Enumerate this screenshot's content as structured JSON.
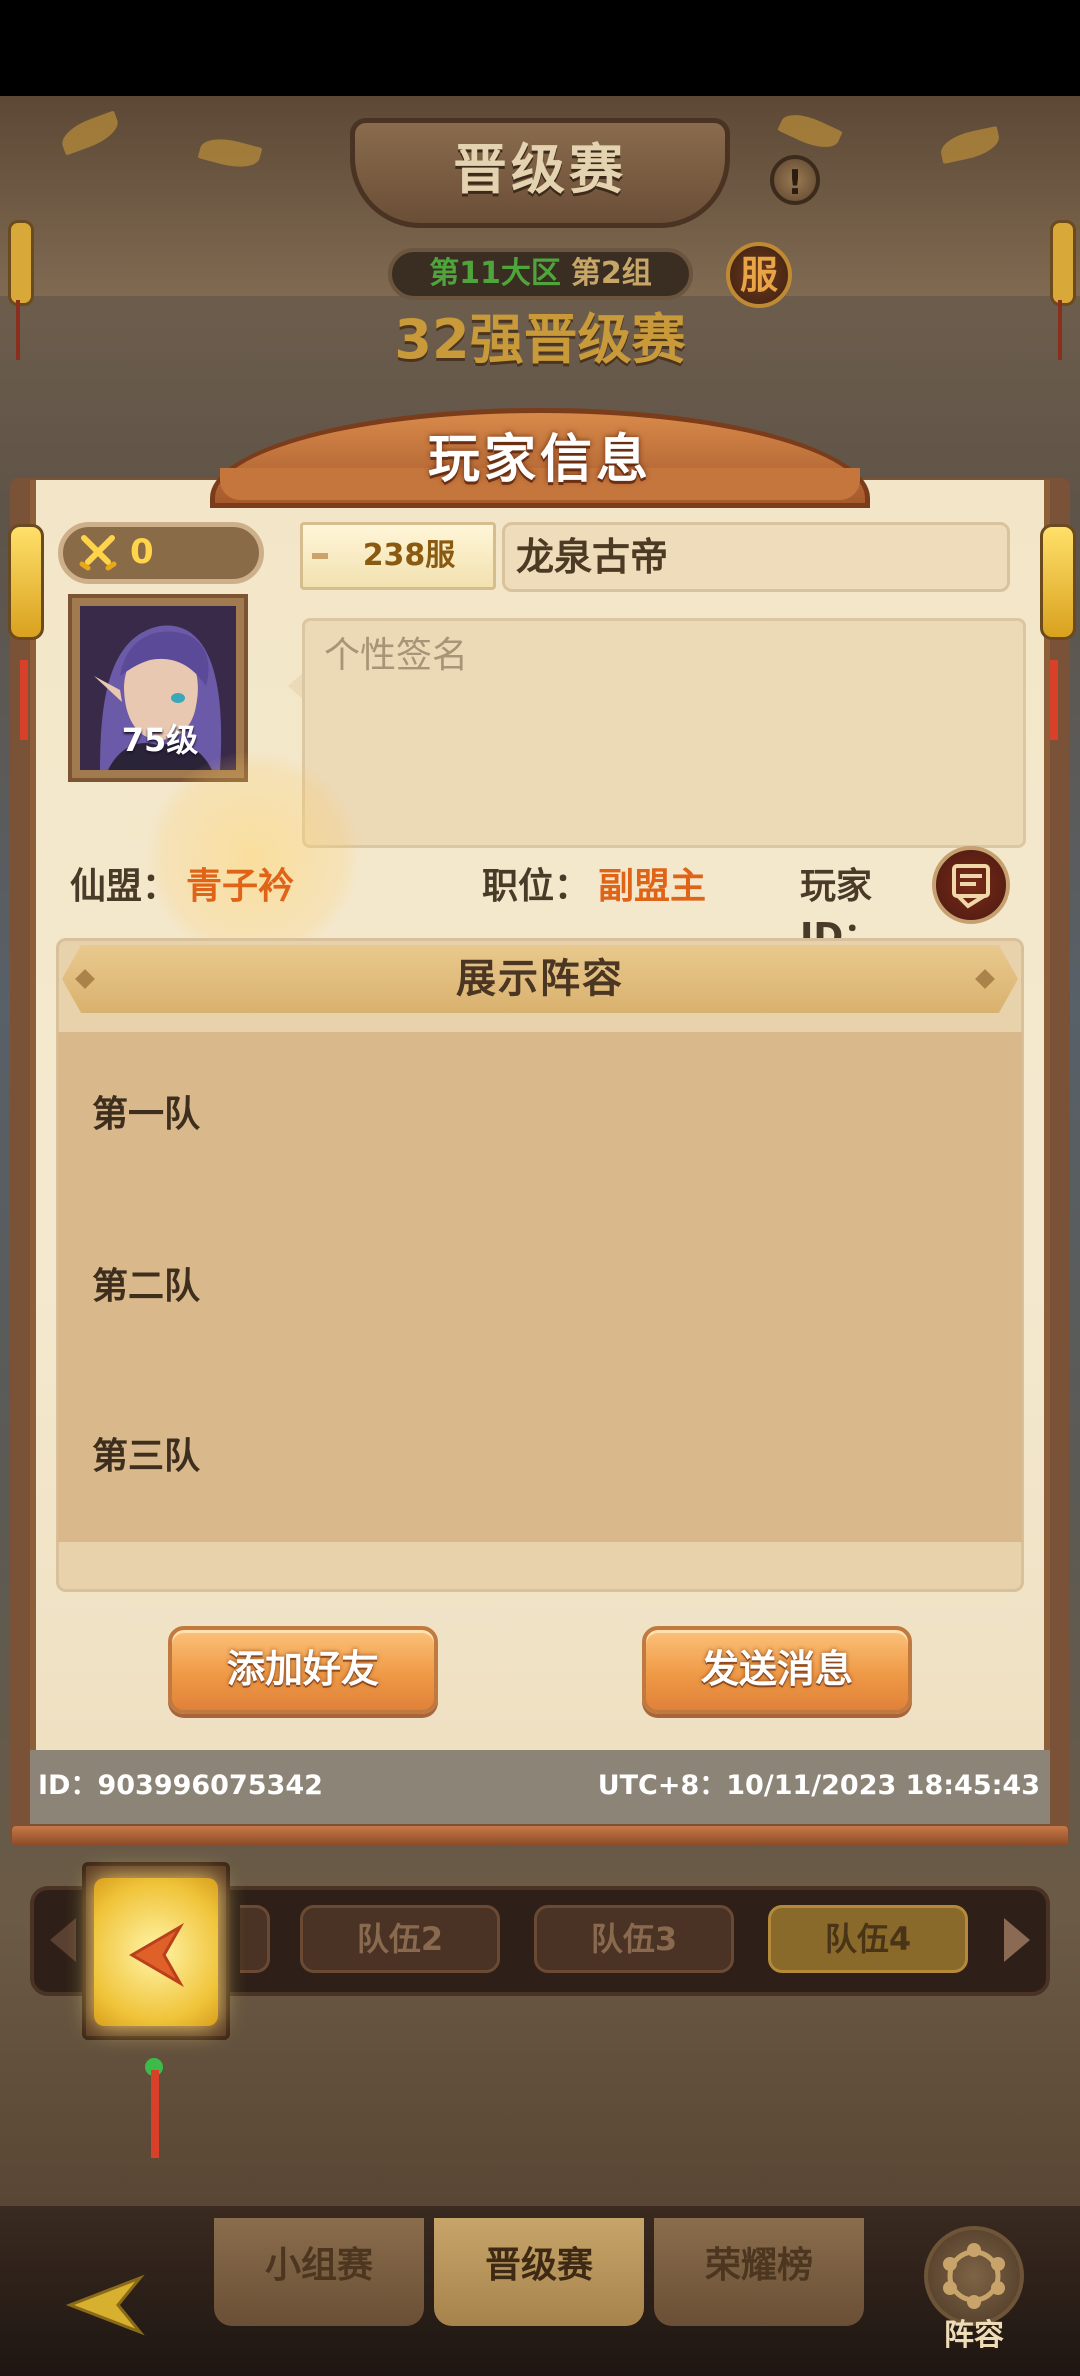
{
  "stage": {
    "title": "晋级赛",
    "info_icon": "!",
    "region_zone": "第11大区",
    "region_group": "第2组",
    "server_badge": "服",
    "subtitle": "32强晋级赛"
  },
  "team_tabs": [
    "队伍2",
    "队伍3",
    "队伍4"
  ],
  "bottom_nav": {
    "tabs": [
      "小组赛",
      "晋级赛",
      "荣耀榜"
    ],
    "formation_label": "阵容"
  },
  "dialog": {
    "title": "玩家信息",
    "power_value": "0",
    "server": "238服",
    "player_name": "龙泉古帝",
    "avatar_level": "75级",
    "signature_placeholder": "个性签名",
    "alliance_label": "仙盟：",
    "alliance_value": "青子衿",
    "position_label": "职位：",
    "position_value": "副盟主",
    "player_id_label": "玩家ID：",
    "lineup_title": "展示阵容",
    "teams": [
      "第一队",
      "第二队",
      "第三队"
    ],
    "add_friend": "添加好友",
    "send_message": "发送消息",
    "footer_id": "ID：903996075342",
    "footer_time": "UTC+8：10/11/2023 18:45:43"
  },
  "icons": {
    "power": "crossed-swords-icon",
    "copy_id": "scroll-copy-icon",
    "back": "back-arrow-icon",
    "formation": "formation-icon"
  },
  "colors": {
    "accent_orange": "#e06418",
    "panel_bg": "#f3e6c8",
    "button_orange": "#ef9a46",
    "lantern_yellow": "#f0c43a"
  }
}
